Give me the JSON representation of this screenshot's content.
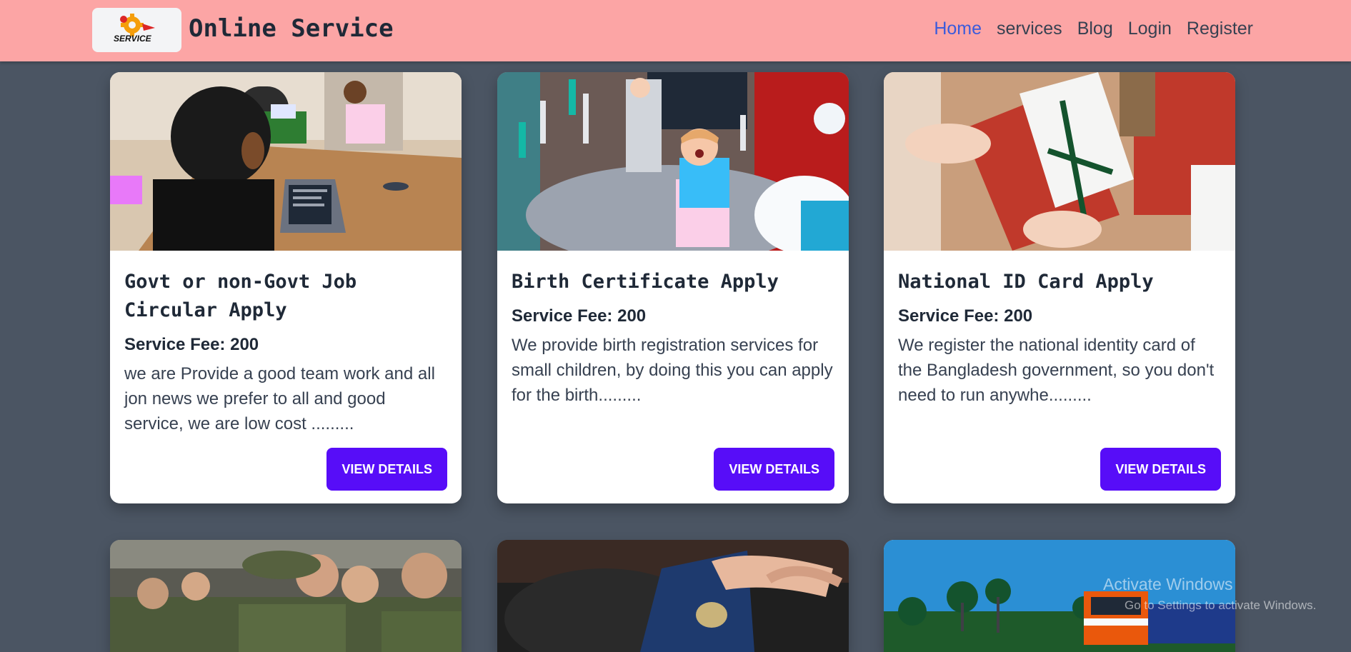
{
  "header": {
    "brand": "Online Service",
    "logo_text": "SERVICE",
    "nav": [
      {
        "label": "Home",
        "active": true
      },
      {
        "label": "services"
      },
      {
        "label": "Blog"
      },
      {
        "label": "Login"
      },
      {
        "label": "Register"
      }
    ]
  },
  "cards": [
    {
      "title": "Govt or non-Govt Job Circular Apply",
      "fee": "Service Fee: 200",
      "description": "we are Provide a good team work and all jon news we prefer to all and good service, we are low cost .........",
      "button": "VIEW DETAILS"
    },
    {
      "title": "Birth Certificate Apply",
      "fee": "Service Fee: 200",
      "description": "We provide birth registration services for small children, by doing this you can apply for the birth.........",
      "button": "VIEW DETAILS"
    },
    {
      "title": "National ID Card Apply",
      "fee": "Service Fee: 200",
      "description": "We register the national identity card of the Bangladesh government, so you don't need to run anywhe.........",
      "button": "VIEW DETAILS"
    }
  ],
  "watermark": {
    "line1": "Activate Windows",
    "line2": "Go to Settings to activate Windows."
  },
  "colors": {
    "navbar": "#fca5a5",
    "page_background": "#4b5563",
    "button": "#570df8",
    "active_link": "#3b5bdb"
  }
}
